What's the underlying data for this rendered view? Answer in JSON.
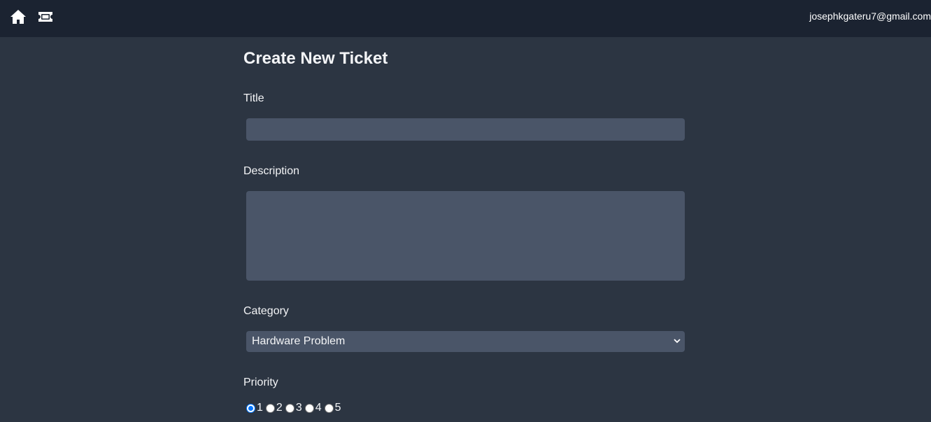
{
  "topbar": {
    "home_icon": "home-icon",
    "ticket_icon": "ticket-icon",
    "user_email": "josephkgateru7@gmail.com"
  },
  "form": {
    "page_title": "Create New Ticket",
    "title_label": "Title",
    "title_value": "",
    "description_label": "Description",
    "description_value": "",
    "category_label": "Category",
    "category_selected": "Hardware Problem",
    "priority_label": "Priority",
    "priority_options": [
      "1",
      "2",
      "3",
      "4",
      "5"
    ],
    "priority_selected": "1"
  },
  "colors": {
    "topbar_bg": "#1b2331",
    "page_bg": "#2c3542",
    "input_bg": "#4a5568",
    "radio_accent": "#0075ff"
  }
}
